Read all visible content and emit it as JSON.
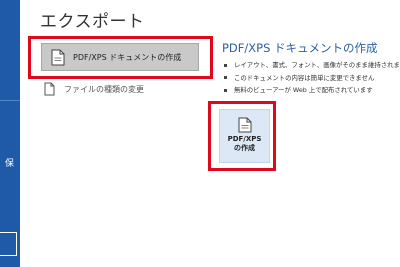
{
  "sidebar": {
    "visible_char": "保"
  },
  "page": {
    "title": "エクスポート"
  },
  "export_items": [
    {
      "label": "PDF/XPS ドキュメントの作成",
      "icon": "document-icon"
    },
    {
      "label": "ファイルの種類の変更",
      "icon": "document-icon"
    }
  ],
  "detail": {
    "title": "PDF/XPS ドキュメントの作成",
    "bullets": [
      "レイアウト、書式、フォント、画像がそのまま維持されます",
      "このドキュメントの内容は簡単に変更できません",
      "無料のビューアーが Web 上で配布されています"
    ],
    "button": {
      "line1": "PDF/XPS",
      "line2": "の作成",
      "icon": "pdf-document-icon"
    }
  },
  "colors": {
    "sidebar": "#1f5aa8",
    "selected_item": "#c9c9c9",
    "accent_title": "#2c5fa3",
    "highlight": "#e0081d",
    "button_bg": "#dce8f6"
  }
}
